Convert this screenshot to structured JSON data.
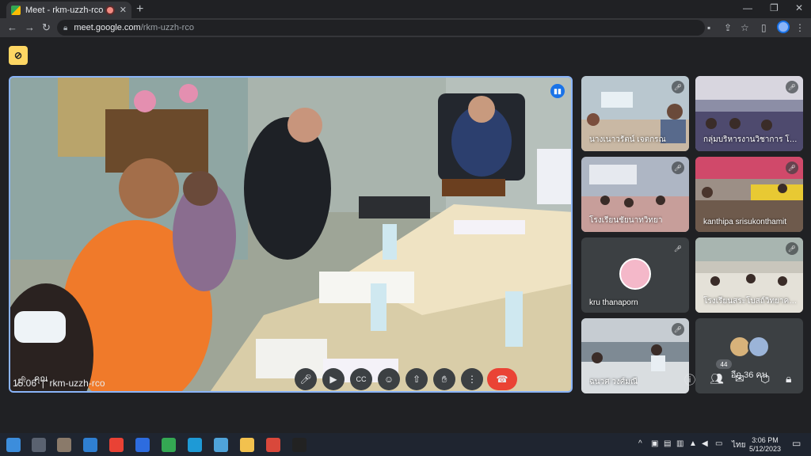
{
  "browser": {
    "tab_title": "Meet - rkm-uzzh-rco",
    "tab_close": "✕",
    "new_tab": "+",
    "url_host": "meet.google.com",
    "url_path": "/rkm-uzzh-rco"
  },
  "meeting": {
    "main_participant_name": "คุณ",
    "tiles": [
      {
        "name": "นางเนาวรัตน์ เจตกรณ"
      },
      {
        "name": "กลุ่มบริหารงานวิชาการ โรงเ..."
      },
      {
        "name": "โรงเรียนชัยนาทวิทยา"
      },
      {
        "name": "kanthipa srisukonthamit"
      },
      {
        "name": "kru thanaporn"
      },
      {
        "name": "โรงเรียนสระโบสถ์วิทยาคาร..."
      },
      {
        "name": "ฉนวศ วงศ์มณี"
      },
      {
        "name": "อีก 36 คน"
      }
    ],
    "time": "15:06",
    "meeting_code": "rkm-uzzh-rco",
    "participant_count": "44"
  },
  "taskbar": {
    "time": "3:06 PM",
    "date": "5/12/2023",
    "lang": "ไทย"
  },
  "icons": {
    "mic": "mic-icon",
    "camera": "camera-icon",
    "captions": "captions-icon",
    "emoji": "emoji-icon",
    "present": "present-icon",
    "hand": "raise-hand-icon",
    "more": "more-icon",
    "end": "end-call-icon"
  }
}
